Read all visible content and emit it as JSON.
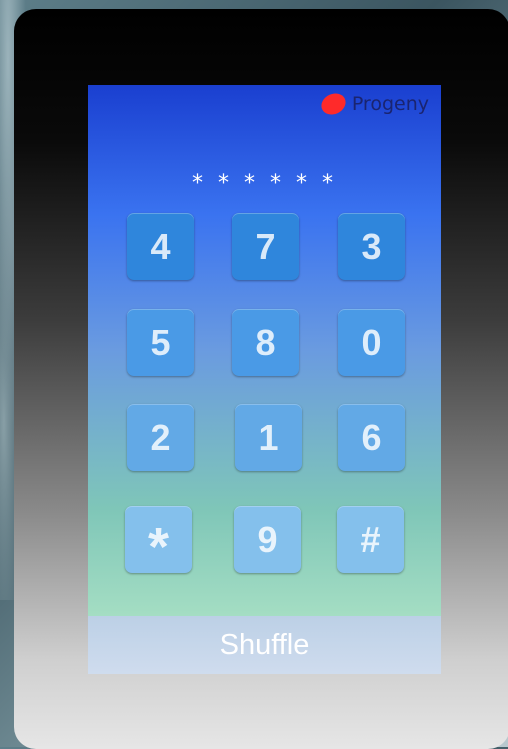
{
  "brand": {
    "name": "Progeny",
    "logo_color": "#ff2a2a"
  },
  "pin_display": "* * * * * *",
  "keypad": {
    "rows": [
      [
        "4",
        "7",
        "3"
      ],
      [
        "5",
        "8",
        "0"
      ],
      [
        "2",
        "1",
        "6"
      ],
      [
        "*",
        "9",
        "#"
      ]
    ]
  },
  "shuffle_label": "Shuffle",
  "colors": {
    "key_dark": "#2f86dc",
    "key_mid": "#4a9ae6",
    "key_light": "#84c0ec"
  }
}
